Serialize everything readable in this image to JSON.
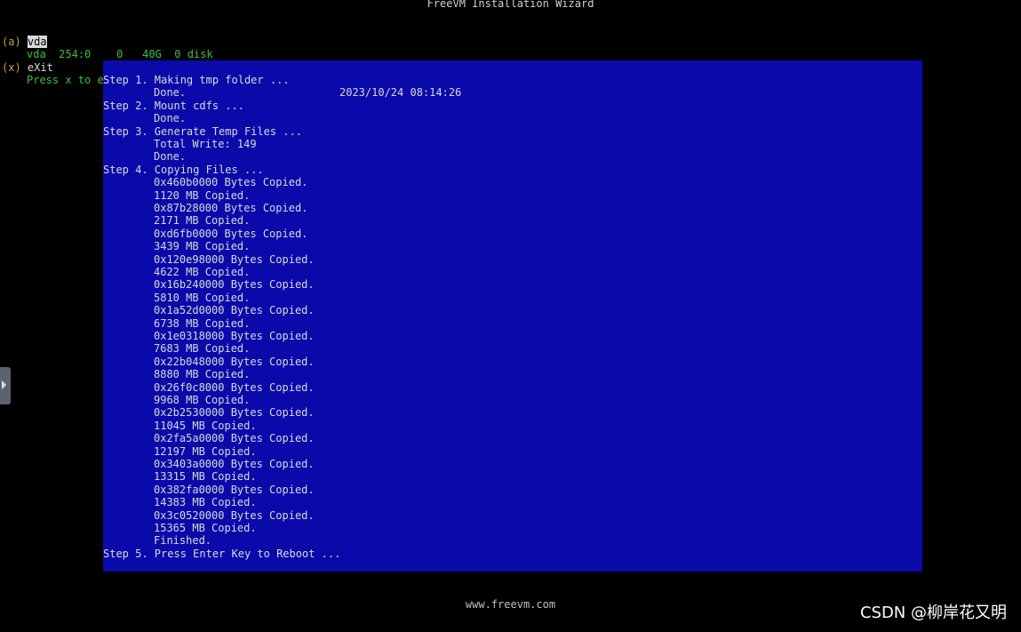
{
  "window": {
    "title": "FreeVM Installation Wizard"
  },
  "menu": {
    "disk_item": {
      "key": "(a)",
      "label": "vda"
    },
    "disk_info": {
      "name": "vda",
      "majmin": "254:0",
      "rm": "0",
      "size": "40G",
      "ro": "0",
      "type": "disk"
    },
    "exit_item": {
      "key": "(x)",
      "label": "eXit"
    },
    "hint": "Press x to e"
  },
  "log": {
    "lines": [
      {
        "text": "Step 1. Making tmp folder ...",
        "indent": false
      },
      {
        "text": "Done.",
        "indent": true,
        "timestamp": "2023/10/24 08:14:26"
      },
      {
        "text": "Step 2. Mount cdfs ...",
        "indent": false
      },
      {
        "text": "Done.",
        "indent": true
      },
      {
        "text": "Step 3. Generate Temp Files ...",
        "indent": false
      },
      {
        "text": "Total Write: 149",
        "indent": true
      },
      {
        "text": "Done.",
        "indent": true
      },
      {
        "text": "Step 4. Copying Files ...",
        "indent": false
      },
      {
        "text": "0x460b0000 Bytes Copied.",
        "indent": true
      },
      {
        "text": "1120 MB Copied.",
        "indent": true
      },
      {
        "text": "0x87b28000 Bytes Copied.",
        "indent": true
      },
      {
        "text": "2171 MB Copied.",
        "indent": true
      },
      {
        "text": "0xd6fb0000 Bytes Copied.",
        "indent": true
      },
      {
        "text": "3439 MB Copied.",
        "indent": true
      },
      {
        "text": "0x120e98000 Bytes Copied.",
        "indent": true
      },
      {
        "text": "4622 MB Copied.",
        "indent": true
      },
      {
        "text": "0x16b240000 Bytes Copied.",
        "indent": true
      },
      {
        "text": "5810 MB Copied.",
        "indent": true
      },
      {
        "text": "0x1a52d0000 Bytes Copied.",
        "indent": true
      },
      {
        "text": "6738 MB Copied.",
        "indent": true
      },
      {
        "text": "0x1e0318000 Bytes Copied.",
        "indent": true
      },
      {
        "text": "7683 MB Copied.",
        "indent": true
      },
      {
        "text": "0x22b048000 Bytes Copied.",
        "indent": true
      },
      {
        "text": "8880 MB Copied.",
        "indent": true
      },
      {
        "text": "0x26f0c8000 Bytes Copied.",
        "indent": true
      },
      {
        "text": "9968 MB Copied.",
        "indent": true
      },
      {
        "text": "0x2b2530000 Bytes Copied.",
        "indent": true
      },
      {
        "text": "11045 MB Copied.",
        "indent": true
      },
      {
        "text": "0x2fa5a0000 Bytes Copied.",
        "indent": true
      },
      {
        "text": "12197 MB Copied.",
        "indent": true
      },
      {
        "text": "0x3403a0000 Bytes Copied.",
        "indent": true
      },
      {
        "text": "13315 MB Copied.",
        "indent": true
      },
      {
        "text": "0x382fa0000 Bytes Copied.",
        "indent": true
      },
      {
        "text": "14383 MB Copied.",
        "indent": true
      },
      {
        "text": "0x3c0520000 Bytes Copied.",
        "indent": true
      },
      {
        "text": "15365 MB Copied.",
        "indent": true
      },
      {
        "text": "Finished.",
        "indent": true
      },
      {
        "text": "Step 5. Press Enter Key to Reboot ...",
        "indent": false
      }
    ]
  },
  "footer": {
    "url": "www.freevm.com"
  },
  "watermark": {
    "text": "CSDN @柳岸花又明"
  },
  "colors": {
    "background": "#000000",
    "dialog_blue": "#0a0aaa",
    "menu_key": "#c8a040",
    "menu_info_green": "#3fbf3f",
    "text_light": "#d8d8d8"
  }
}
